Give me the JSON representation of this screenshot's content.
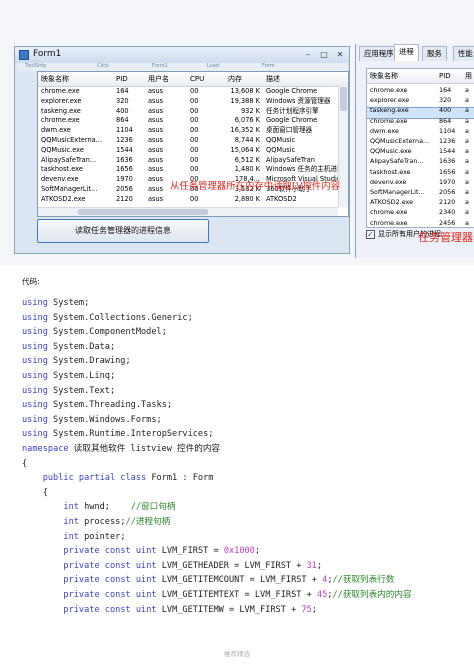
{
  "form1": {
    "title": "Form1",
    "menu_faint": [
      "ToolStrip",
      "Click",
      "Form1",
      "Load",
      "Form"
    ],
    "columns": [
      "映象名称",
      "PID",
      "用户名",
      "CPU",
      "内存",
      "描述"
    ],
    "rows": [
      [
        "chrome.exe",
        "164",
        "asus",
        "00",
        "13,608 K",
        "Google Chrome"
      ],
      [
        "explorer.exe",
        "320",
        "asus",
        "00",
        "19,388 K",
        "Windows 资源管理器"
      ],
      [
        "taskeng.exe",
        "400",
        "asus",
        "00",
        "932 K",
        "任务计划程序引擎"
      ],
      [
        "chrome.exe",
        "864",
        "asus",
        "00",
        "6,076 K",
        "Google Chrome"
      ],
      [
        "dwm.exe",
        "1104",
        "asus",
        "00",
        "16,352 K",
        "桌面窗口管理器"
      ],
      [
        "QQMusicExterna...",
        "1236",
        "asus",
        "00",
        "8,744 K",
        "QQMusic"
      ],
      [
        "QQMusic.exe",
        "1544",
        "asus",
        "00",
        "15,064 K",
        "QQMusic"
      ],
      [
        "AlipaySafeTran...",
        "1636",
        "asus",
        "00",
        "6,512 K",
        "AlipaySafeTran"
      ],
      [
        "taskhost.exe",
        "1656",
        "asus",
        "00",
        "1,480 K",
        "Windows 任务的主机进程"
      ],
      [
        "devenv.exe",
        "1970",
        "asus",
        "00",
        "178,4...",
        "Microsoft Visual Studio"
      ],
      [
        "SoftManagerLit...",
        "2056",
        "asus",
        "00",
        "3,532 K",
        "360软件小助手"
      ],
      [
        "ATKOSD2.exe",
        "2120",
        "asus",
        "00",
        "2,880 K",
        "ATKOSD2"
      ]
    ],
    "button_label": "读取任务管理器的进程信息",
    "red_note": "从任务管理器所在内存中读取LV控件内容"
  },
  "taskmgr": {
    "tabs": [
      "应用程序",
      "进程",
      "服务",
      "性能"
    ],
    "columns": [
      "映象名称",
      "PID",
      "用"
    ],
    "rows": [
      [
        "chrome.exe",
        "164",
        "a"
      ],
      [
        "explorer.exe",
        "320",
        "a"
      ],
      [
        "taskeng.exe",
        "400",
        "a"
      ],
      [
        "chrome.exe",
        "864",
        "a"
      ],
      [
        "dwm.exe",
        "1104",
        "a"
      ],
      [
        "QQMusicExterna...",
        "1236",
        "a"
      ],
      [
        "QQMusic.exe",
        "1544",
        "a"
      ],
      [
        "AlipaySafeTran...",
        "1636",
        "a"
      ],
      [
        "taskhost.exe",
        "1656",
        "a"
      ],
      [
        "devenv.exe",
        "1970",
        "a"
      ],
      [
        "SoftManagerLit...",
        "2056",
        "a"
      ],
      [
        "ATKOSD2.exe",
        "2120",
        "a"
      ],
      [
        "chrome.exe",
        "2340",
        "a"
      ],
      [
        "chrome.exe",
        "2456",
        "a"
      ]
    ],
    "show_all_label": "显示所有用户的进程",
    "red_note": "任务管理器"
  },
  "code": {
    "heading": "代码:",
    "lines": [
      [
        [
          "kw",
          "using"
        ],
        [
          "t",
          " System;"
        ]
      ],
      [
        [
          "kw",
          "using"
        ],
        [
          "t",
          " System.Collections.Generic;"
        ]
      ],
      [
        [
          "kw",
          "using"
        ],
        [
          "t",
          " System.ComponentModel;"
        ]
      ],
      [
        [
          "kw",
          "using"
        ],
        [
          "t",
          " System.Data;"
        ]
      ],
      [
        [
          "kw",
          "using"
        ],
        [
          "t",
          " System.Drawing;"
        ]
      ],
      [
        [
          "kw",
          "using"
        ],
        [
          "t",
          " System.Linq;"
        ]
      ],
      [
        [
          "kw",
          "using"
        ],
        [
          "t",
          " System.Text;"
        ]
      ],
      [
        [
          "kw",
          "using"
        ],
        [
          "t",
          " System.Threading.Tasks;"
        ]
      ],
      [
        [
          "kw",
          "using"
        ],
        [
          "t",
          " System.Windows.Forms;"
        ]
      ],
      [
        [
          "kw",
          "using"
        ],
        [
          "t",
          " System.Runtime.InteropServices;"
        ]
      ],
      [
        [
          "kw",
          "namespace"
        ],
        [
          "t",
          " 读取其他软件 listview 控件的内容"
        ]
      ],
      [
        [
          "t",
          "{"
        ]
      ],
      [
        [
          "t",
          "    "
        ],
        [
          "kw",
          "public partial class"
        ],
        [
          "t",
          " Form1 : Form"
        ]
      ],
      [
        [
          "t",
          "    {"
        ]
      ],
      [
        [
          "t",
          "        "
        ],
        [
          "kw",
          "int"
        ],
        [
          "t",
          " hwnd;    "
        ],
        [
          "cm",
          "//窗口句柄"
        ]
      ],
      [
        [
          "t",
          "        "
        ],
        [
          "kw",
          "int"
        ],
        [
          "t",
          " process;"
        ],
        [
          "cm",
          "//进程句柄"
        ]
      ],
      [
        [
          "t",
          "        "
        ],
        [
          "kw",
          "int"
        ],
        [
          "t",
          " pointer;"
        ]
      ],
      [
        [
          "t",
          "        "
        ],
        [
          "kw",
          "private const uint"
        ],
        [
          "t",
          " LVM_FIRST = "
        ],
        [
          "num",
          "0x1000"
        ],
        [
          "t",
          ";"
        ]
      ],
      [
        [
          "t",
          "        "
        ],
        [
          "kw",
          "private const uint"
        ],
        [
          "t",
          " LVM_GETHEADER = LVM_FIRST + "
        ],
        [
          "num",
          "31"
        ],
        [
          "t",
          ";"
        ]
      ],
      [
        [
          "t",
          "        "
        ],
        [
          "kw",
          "private const uint"
        ],
        [
          "t",
          " LVM_GETITEMCOUNT = LVM_FIRST + "
        ],
        [
          "num",
          "4"
        ],
        [
          "t",
          ";"
        ],
        [
          "cm",
          "//获取列表行数"
        ]
      ],
      [
        [
          "t",
          "        "
        ],
        [
          "kw",
          "private const uint"
        ],
        [
          "t",
          " LVM_GETITEMTEXT = LVM_FIRST + "
        ],
        [
          "num",
          "45"
        ],
        [
          "t",
          ";"
        ],
        [
          "cm",
          "//获取列表内的内容"
        ]
      ],
      [
        [
          "t",
          "        "
        ],
        [
          "kw",
          "private const uint"
        ],
        [
          "t",
          " LVM_GETITEMW = LVM_FIRST + "
        ],
        [
          "num",
          "75"
        ],
        [
          "t",
          ";"
        ]
      ]
    ]
  },
  "footer": "推荐精选"
}
